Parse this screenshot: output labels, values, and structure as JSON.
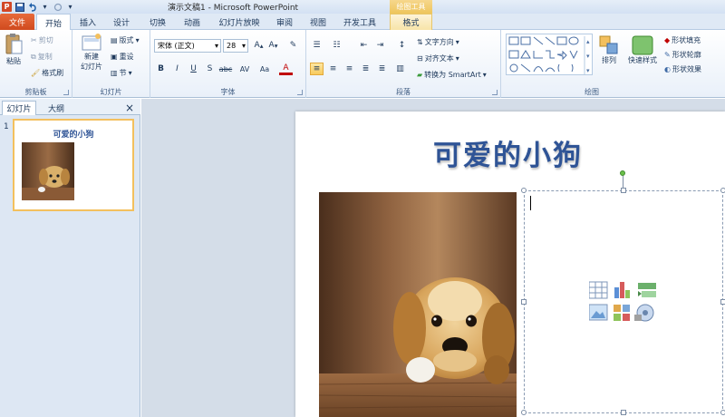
{
  "window": {
    "title": "演示文稿1 - Microsoft PowerPoint",
    "context_group": "绘图工具",
    "app_letter": "P"
  },
  "tabs": {
    "file": "文件",
    "home": "开始",
    "insert": "插入",
    "design": "设计",
    "transitions": "切换",
    "animations": "动画",
    "slideshow": "幻灯片放映",
    "review": "审阅",
    "view": "视图",
    "developer": "开发工具",
    "format": "格式"
  },
  "ribbon": {
    "clipboard": {
      "label": "剪贴板",
      "paste": "粘贴",
      "cut": "剪切",
      "copy": "复制",
      "format_painter": "格式刷"
    },
    "slides": {
      "label": "幻灯片",
      "new_slide_line1": "新建",
      "new_slide_line2": "幻灯片",
      "layout": "版式",
      "reset": "重设",
      "section": "节"
    },
    "font": {
      "label": "字体",
      "font_name": "宋体 (正文)",
      "font_size": "28",
      "bold": "B",
      "italic": "I",
      "underline": "U",
      "shadow": "S",
      "strike": "abc",
      "spacing": "AV",
      "case": "Aa",
      "color": "A"
    },
    "paragraph": {
      "label": "段落",
      "text_direction": "文字方向",
      "align_text": "对齐文本",
      "smartart": "转换为 SmartArt"
    },
    "drawing": {
      "label": "绘图",
      "arrange": "排列",
      "quick_styles": "快速样式",
      "shape_fill": "形状填充",
      "shape_outline": "形状轮廓",
      "shape_effects": "形状效果"
    }
  },
  "left_pane": {
    "tab_slides": "幻灯片",
    "tab_outline": "大纲",
    "close": "×",
    "slide_number": "1",
    "thumb_title": "可爱的小狗"
  },
  "slide": {
    "title": "可爱的小狗"
  },
  "colors": {
    "accent_orange": "#d04a1e",
    "title_blue": "#2f5496",
    "ribbon_bg": "#e9f0f9",
    "highlight": "#f8ca5c"
  }
}
